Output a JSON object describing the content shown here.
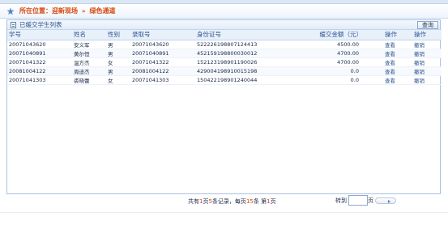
{
  "breadcrumb": {
    "prefix": "所在位置：",
    "level1": "迎新现场",
    "separator": "»",
    "level2": "绿色通道"
  },
  "panel": {
    "title": "已缓交学生列表",
    "query_label": "查询"
  },
  "table": {
    "headers": [
      "学号",
      "姓名",
      "性别",
      "录取号",
      "身份证号",
      "缓交金额（元）",
      "操作",
      "操作"
    ],
    "rows": [
      {
        "student_id": "20071043620",
        "name": "安义军",
        "gender": "男",
        "admission_no": "20071043620",
        "id_card": "522226198807124413",
        "amount": "4500.00",
        "view": "查看",
        "cancel": "撤销"
      },
      {
        "student_id": "20071040891",
        "name": "黄尔恒",
        "gender": "男",
        "admission_no": "20071040891",
        "id_card": "452159198800030012",
        "amount": "4700.00",
        "view": "查看",
        "cancel": "撤销"
      },
      {
        "student_id": "20071041322",
        "name": "温方杰",
        "gender": "女",
        "admission_no": "20071041322",
        "id_card": "152123198901190026",
        "amount": "4700.00",
        "view": "查看",
        "cancel": "撤销"
      },
      {
        "student_id": "20081004122",
        "name": "周迪杰",
        "gender": "男",
        "admission_no": "20081004122",
        "id_card": "429004198910015198",
        "amount": "0.0",
        "view": "查看",
        "cancel": "撤销"
      },
      {
        "student_id": "20071041303",
        "name": "裘晓蕾",
        "gender": "女",
        "admission_no": "20071041303",
        "id_card": "150422198901240044",
        "amount": "0.0",
        "view": "查看",
        "cancel": "撤销"
      }
    ]
  },
  "pager": {
    "text_1": "共有",
    "total_pages": "1",
    "text_2": "页",
    "total_records": "5",
    "text_3": "条记录，每页",
    "page_size": "15",
    "text_4": "条  第",
    "current_page": "1",
    "text_5": "页",
    "jump_label": "转到",
    "jump_unit": "页",
    "jump_value": ""
  },
  "colors": {
    "accent_orange": "#d9480f",
    "link_blue": "#2f5590",
    "border_blue": "#a9c1e0"
  }
}
